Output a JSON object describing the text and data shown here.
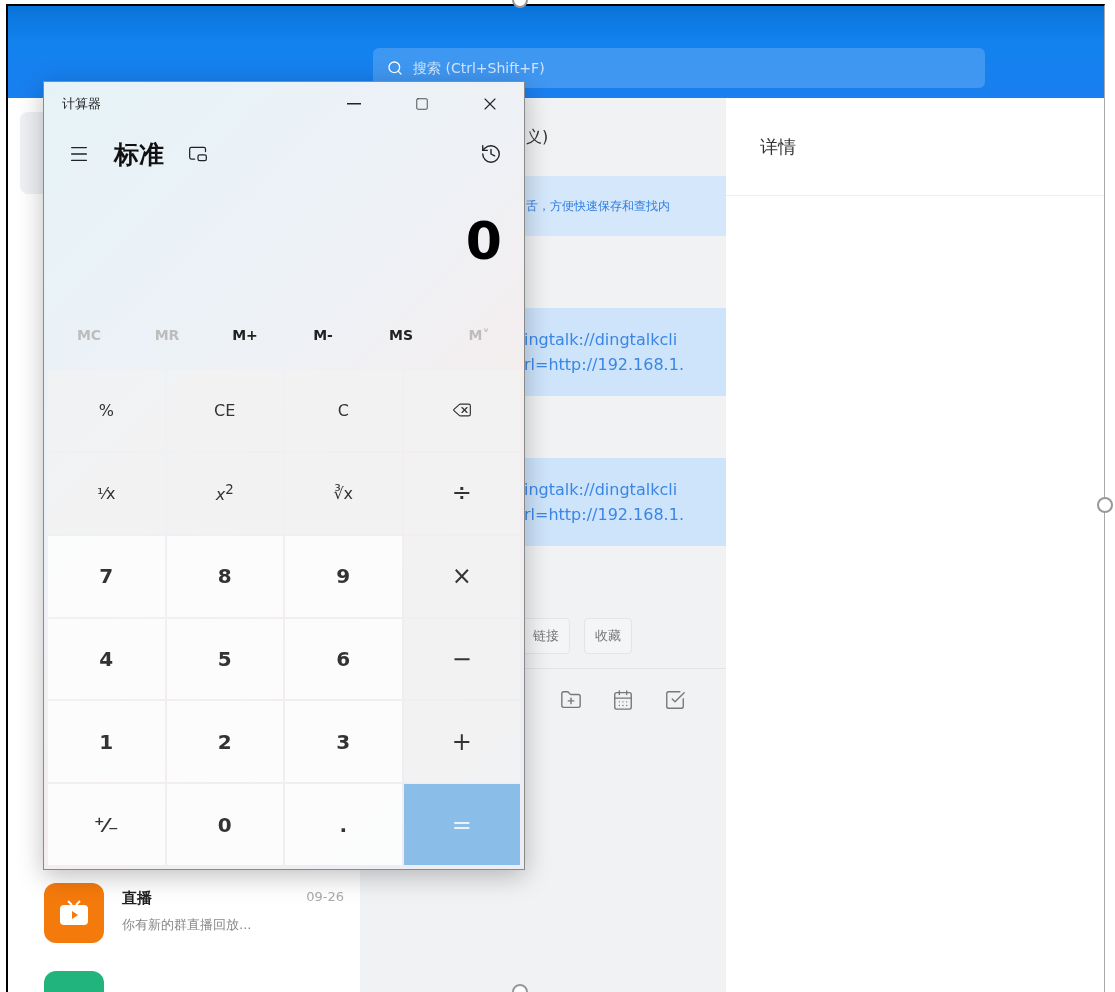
{
  "search": {
    "placeholder": "搜索 (Ctrl+Shift+F)"
  },
  "chat": {
    "title": "义)",
    "notice": "舌，方便快速保存和查找内",
    "messages": [
      {
        "lines": [
          "ingtalk://dingtalkcli",
          "rl=http://192.168.1."
        ]
      },
      {
        "lines": [
          "ingtalk://dingtalkcli",
          "rl=http://192.168.1."
        ]
      }
    ],
    "tags": [
      "链接",
      "收藏"
    ]
  },
  "details": {
    "title": "详情"
  },
  "conversations": [
    {
      "name": "直播",
      "time": "09-26",
      "preview": "你有新的群直播回放...",
      "color": "#f57a0c"
    },
    {
      "color": "#21b47c"
    }
  ],
  "calculator": {
    "title": "计算器",
    "mode": "标准",
    "display": "0",
    "memory": [
      {
        "label": "MC",
        "disabled": true
      },
      {
        "label": "MR",
        "disabled": true
      },
      {
        "label": "M+",
        "disabled": false
      },
      {
        "label": "M-",
        "disabled": false
      },
      {
        "label": "MS",
        "disabled": false
      },
      {
        "label": "M˅",
        "disabled": true
      }
    ],
    "keys": [
      {
        "label": "%",
        "kind": "fn"
      },
      {
        "label": "CE",
        "kind": "fn"
      },
      {
        "label": "C",
        "kind": "fn"
      },
      {
        "kind": "backspace"
      },
      {
        "label": "¹⁄x",
        "kind": "fn"
      },
      {
        "label": "*x*$^{2}$",
        "kind": "fn"
      },
      {
        "label": "∛x",
        "kind": "fn"
      },
      {
        "label": "÷",
        "kind": "op"
      },
      {
        "label": "7",
        "kind": "digit"
      },
      {
        "label": "8",
        "kind": "digit"
      },
      {
        "label": "9",
        "kind": "digit"
      },
      {
        "label": "×",
        "kind": "op"
      },
      {
        "label": "4",
        "kind": "digit"
      },
      {
        "label": "5",
        "kind": "digit"
      },
      {
        "label": "6",
        "kind": "digit"
      },
      {
        "label": "−",
        "kind": "op"
      },
      {
        "label": "1",
        "kind": "digit"
      },
      {
        "label": "2",
        "kind": "digit"
      },
      {
        "label": "3",
        "kind": "digit"
      },
      {
        "label": "+",
        "kind": "op"
      },
      {
        "label": "⁺⁄₋",
        "kind": "digit"
      },
      {
        "label": "0",
        "kind": "digit"
      },
      {
        "label": ".",
        "kind": "digit"
      },
      {
        "label": "=",
        "kind": "equals"
      }
    ]
  }
}
